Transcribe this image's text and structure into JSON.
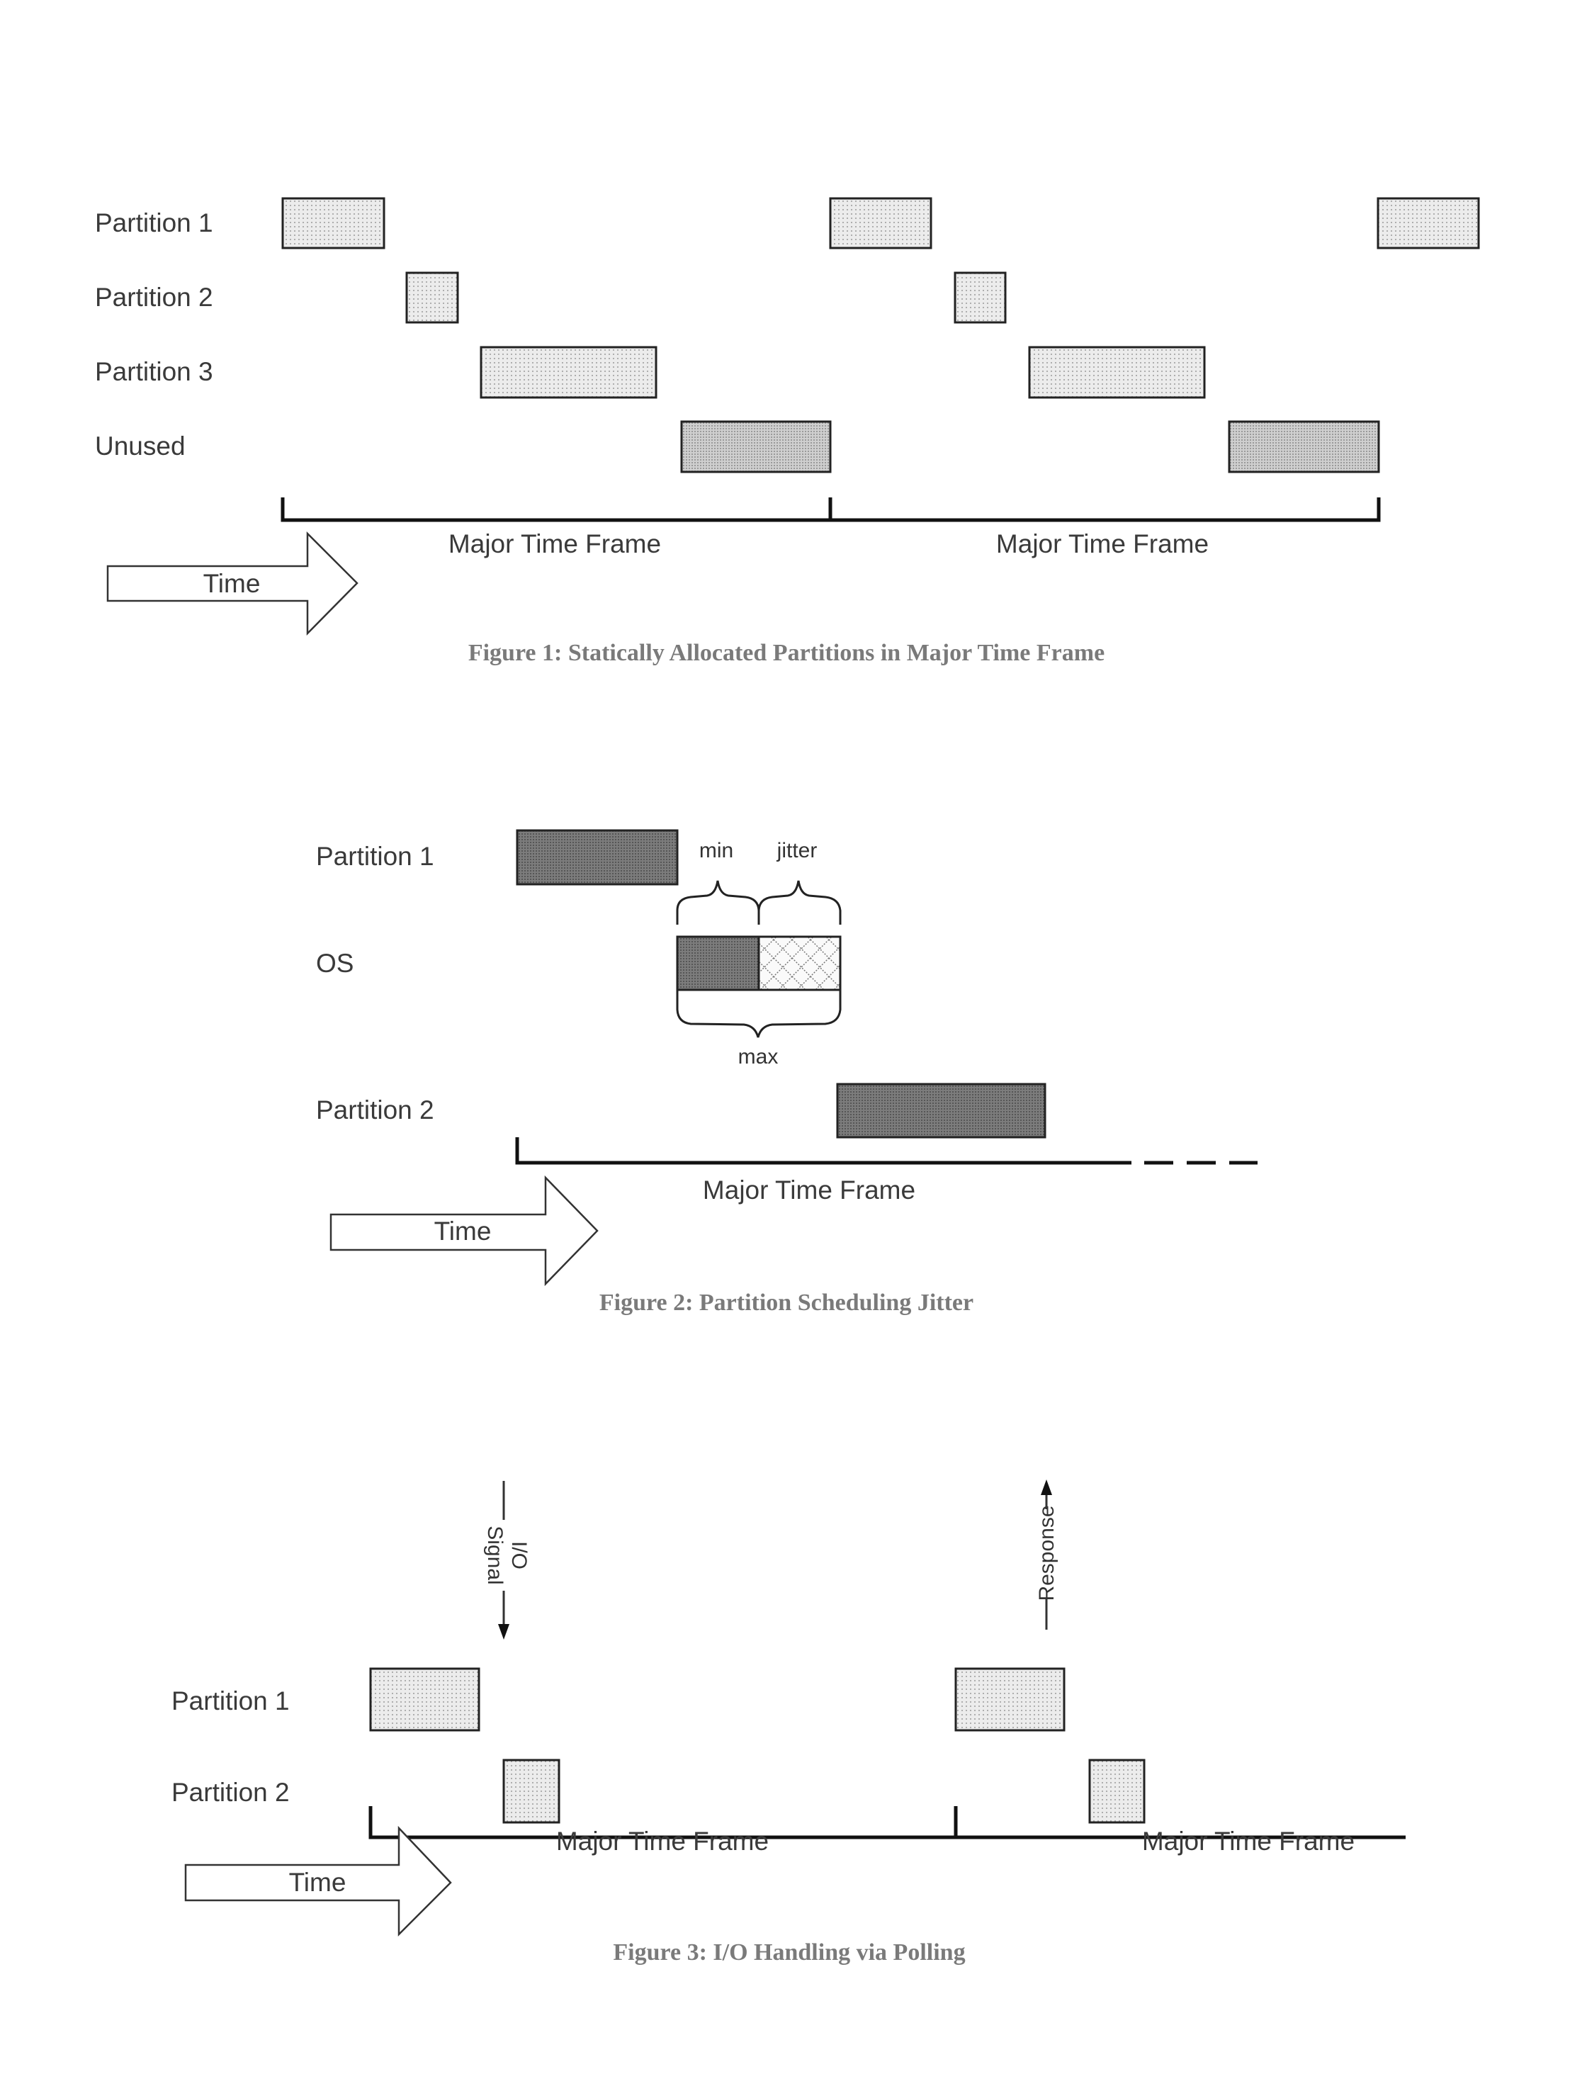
{
  "figures": [
    {
      "id": "fig1",
      "caption": "Figure 1: Statically Allocated Partitions in Major Time Frame",
      "rows": [
        "Partition 1",
        "Partition 2",
        "Partition 3",
        "Unused"
      ],
      "frame_label": "Major Time Frame",
      "time_label": "Time",
      "frames": 2
    },
    {
      "id": "fig2",
      "caption": "Figure 2: Partition Scheduling Jitter",
      "rows": [
        "Partition 1",
        "OS",
        "Partition 2"
      ],
      "annotations": {
        "min": "min",
        "jitter": "jitter",
        "max": "max"
      },
      "frame_label": "Major Time Frame",
      "time_label": "Time"
    },
    {
      "id": "fig3",
      "caption": "Figure 3: I/O Handling via Polling",
      "rows": [
        "Partition 1",
        "Partition 2"
      ],
      "signal_label_line1": "I/O",
      "signal_label_line2": "Signal",
      "response_label": "Response",
      "frame_label": "Major Time Frame",
      "time_label": "Time",
      "frames": 2
    }
  ],
  "colors": {
    "light_fill": "#e6e6e6",
    "unused_fill": "#c8c8c8",
    "dark_fill": "#7a7a7a",
    "caption": "#7a7a7a"
  }
}
